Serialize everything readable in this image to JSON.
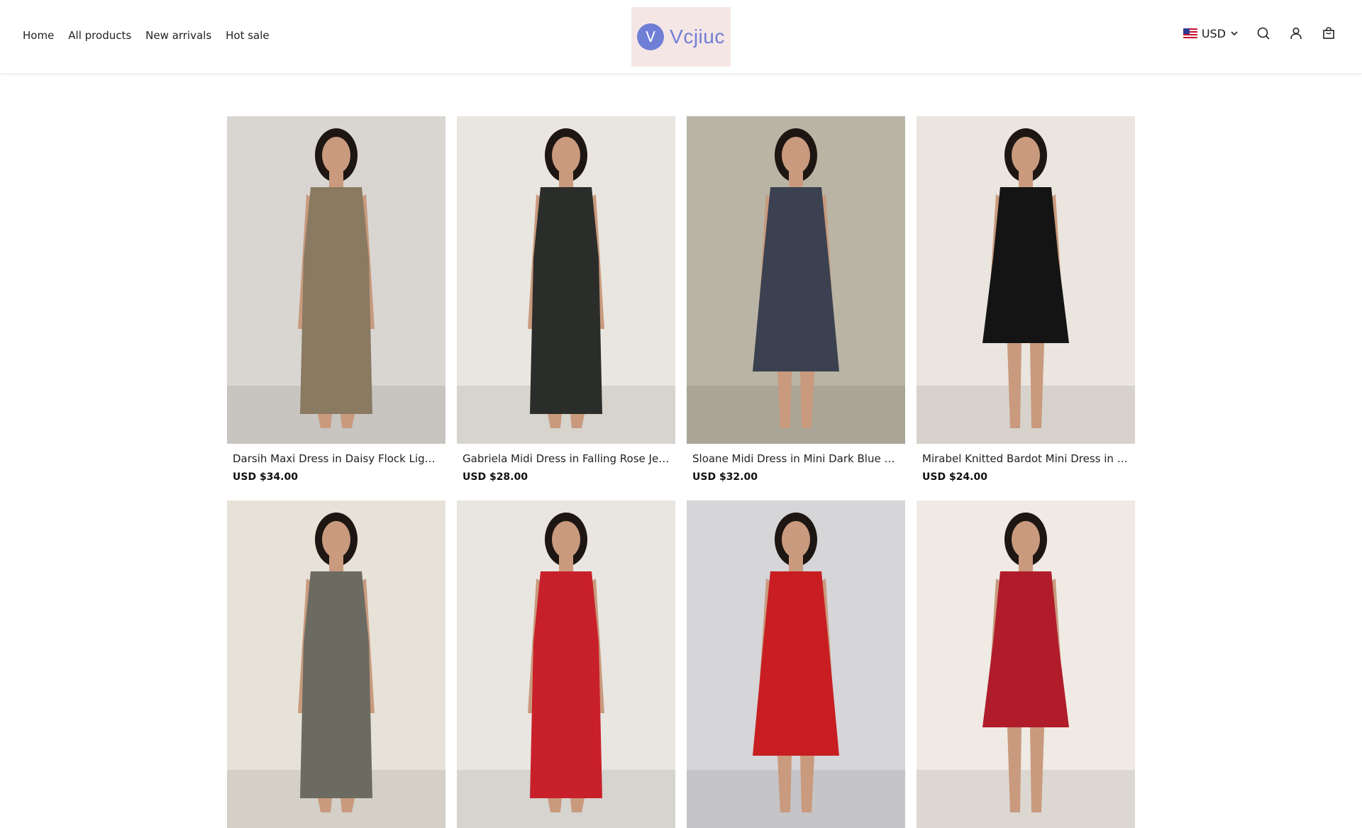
{
  "nav": {
    "items": [
      {
        "label": "Home"
      },
      {
        "label": "All products"
      },
      {
        "label": "New arrivals"
      },
      {
        "label": "Hot sale"
      }
    ]
  },
  "logo": {
    "initial": "V",
    "text": "Vcjiuc"
  },
  "currency": {
    "label": "USD"
  },
  "icons": [
    "search-icon",
    "account-icon",
    "cart-icon",
    "chevron-down-icon",
    "us-flag-icon"
  ],
  "products": [
    {
      "title": "Darsih Maxi Dress in Daisy Flock Light B...",
      "price": "USD $34.00",
      "bg": "#d9d6d2",
      "dress": "#8a7a62"
    },
    {
      "title": "Gabriela Midi Dress in Falling Rose Jet B...",
      "price": "USD $28.00",
      "bg": "#e9e6df",
      "dress": "#2b2d2a"
    },
    {
      "title": "Sloane Midi Dress in Mini Dark Blue Gin...",
      "price": "USD $32.00",
      "bg": "#b9b4a4",
      "dress": "#3b4150"
    },
    {
      "title": "Mirabel Knitted Bardot Mini Dress in Bla...",
      "price": "USD $24.00",
      "bg": "#eae5de",
      "dress": "#141414"
    },
    {
      "title": "",
      "price": "",
      "bg": "#e7e2d8",
      "dress": "#6b6b62"
    },
    {
      "title": "",
      "price": "",
      "bg": "#e9e6e1",
      "dress": "#c8202a"
    },
    {
      "title": "",
      "price": "",
      "bg": "#d6d5d8",
      "dress": "#c81e22"
    },
    {
      "title": "",
      "price": "",
      "bg": "#efeae3",
      "dress": "#b01c2a"
    }
  ]
}
